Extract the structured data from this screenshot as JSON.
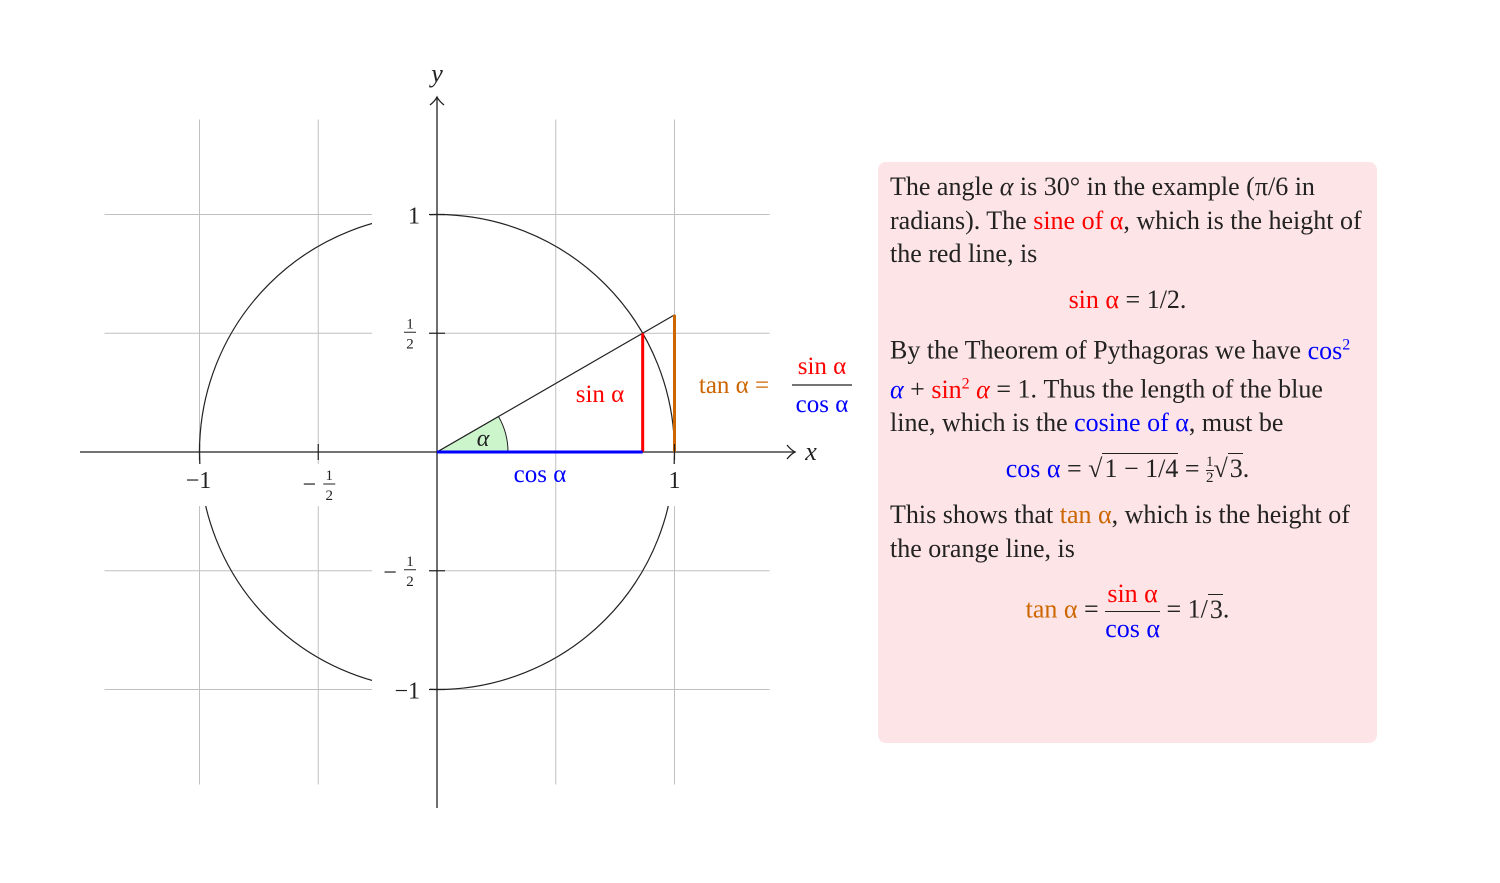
{
  "figure": {
    "axis_labels": {
      "x": "x",
      "y": "y"
    },
    "tick_labels_x": [
      {
        "value": -1,
        "label": "−1"
      },
      {
        "value": -0.5,
        "label": "−",
        "frac": [
          "1",
          "2"
        ]
      },
      {
        "value": 1,
        "label": "1"
      }
    ],
    "tick_labels_y": [
      {
        "value": 1,
        "label": "1"
      },
      {
        "value": 0.5,
        "label": "",
        "frac": [
          "1",
          "2"
        ]
      },
      {
        "value": -0.5,
        "label": "−",
        "frac": [
          "1",
          "2"
        ]
      },
      {
        "value": -1,
        "label": "−1"
      }
    ],
    "angle_deg": 30,
    "angle_label": "α",
    "sin_label": "sin α",
    "cos_label": "cos α",
    "tan_label": "tan α =",
    "tan_num": "sin α",
    "tan_den": "cos α",
    "colors": {
      "sin": "#ff0000",
      "cos": "#0000ff",
      "tan": "#cc6600",
      "angle_fill": "#ccf5cc",
      "grid": "#c0c0c0",
      "box": "#fde4e6"
    }
  },
  "text_box": {
    "p1": [
      "The angle ",
      "α",
      " is 30° in the example (π/6 in radians). The ",
      "sine of α",
      ", which is the height of the red line, is"
    ],
    "eq1": [
      "sin α",
      " = 1/2."
    ],
    "p2": [
      "By the Theorem of Pythagoras we have ",
      "cos",
      "2",
      " α",
      " + ",
      "sin",
      "2",
      " α",
      " = 1. Thus the length of the blue line, which is the ",
      "cosine of α",
      ", must be"
    ],
    "eq2": [
      "cos α",
      " = ",
      "1 − 1/4",
      " = ",
      "1",
      "2",
      "3",
      "."
    ],
    "p3": [
      "This shows that ",
      "tan α",
      ", which is the height of the orange line, is"
    ],
    "eq3": [
      "tan α",
      " = ",
      "sin α",
      "cos α",
      " = 1/",
      "3",
      "."
    ]
  }
}
